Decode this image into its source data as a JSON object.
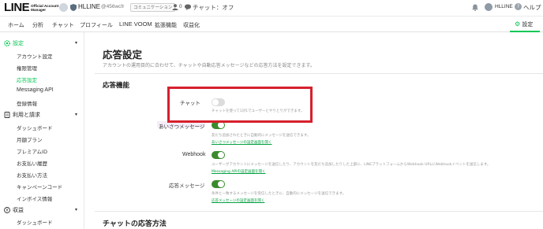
{
  "topbar": {
    "logo_main": "LINE",
    "logo_sub_1": "Official Account",
    "logo_sub_2": "Manager",
    "account_name": "HLLINE",
    "account_id": "@456wcfr",
    "plan_badge": "コミュニケーション",
    "friend_count": "0",
    "chat_status": "チャット：オフ",
    "user_name": "HLLINE",
    "help_label": "ヘルプ"
  },
  "nav": {
    "items": [
      "ホーム",
      "分析",
      "チャット",
      "プロフィール",
      "LINE VOOM",
      "拡張機能",
      "収益化"
    ],
    "settings": "設定"
  },
  "sidebar": {
    "section_settings": "設定",
    "settings_items": [
      "アカウント設定",
      "権限管理",
      "応答設定",
      "Messaging API",
      "登録情報"
    ],
    "section_billing": "利用と請求",
    "billing_items": [
      "ダッシュボード",
      "月額プラン",
      "プレミアムID",
      "お支払い履歴",
      "お支払い方法",
      "キャンペーンコード",
      "インボイス情報"
    ],
    "section_revenue": "収益",
    "revenue_items": [
      "ダッシュボード"
    ]
  },
  "main": {
    "title": "応答設定",
    "description": "アカウントの運用目的に合わせて、チャットや自動応答メッセージなどの応答方法を設定できます。",
    "section_features": "応答機能",
    "section_chat_method": "チャットの応答方法",
    "rows": [
      {
        "label": "チャット",
        "on": false,
        "desc": "チャットを使って1対1でユーザーとやりとりができます。",
        "link": ""
      },
      {
        "label": "あいさつメッセージ",
        "on": true,
        "desc": "友だち追加されたときに自動的にメッセージを送信できます。",
        "link": "あいさつメッセージの設定画面を開く"
      },
      {
        "label": "Webhook",
        "on": true,
        "desc": "ユーザーがアカウントにメッセージを送信したり、アカウントを友だち追加したりした上部に、LINEプラットフォームからWebhook URLにWebhookイベントを送信します。",
        "link": "Messaging APIの設定画面を開く"
      },
      {
        "label": "応答メッセージ",
        "on": true,
        "desc": "条件と一致するメッセージを受信したときに、自動的にメッセージを送信できます。",
        "link": "応答メッセージの設定画面を開く"
      }
    ]
  },
  "colors": {
    "accent": "#06c755",
    "toggle_on": "#3c8a2e",
    "highlight_box": "#d6202d"
  }
}
